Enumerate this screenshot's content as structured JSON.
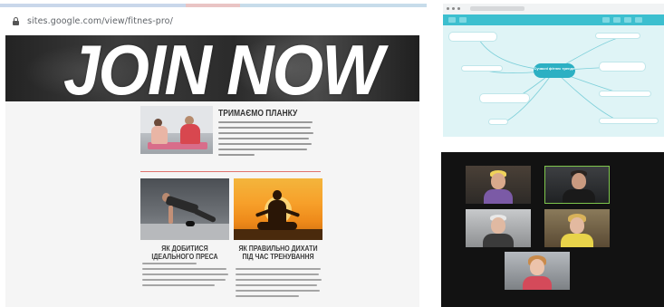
{
  "website": {
    "url": "sites.google.com/view/fitnes-pro/",
    "hero_title": "JOIN NOW",
    "article": {
      "title": "ТРИМАЄМО ПЛАНКУ"
    },
    "cards": [
      {
        "title": "ЯК ДОБИТИСЯ ІДЕАЛЬНОГО ПРЕСА"
      },
      {
        "title": "ЯК ПРАВИЛЬНО ДИХАТИ ПІД ЧАС ТРЕНУВАННЯ"
      }
    ]
  },
  "mindmap": {
    "center": "Сучасні фітнес тренди"
  },
  "colors": {
    "accent_divider": "#e0736f",
    "mindmap_bg": "#dff4f6",
    "mindmap_center": "#2cb0c3",
    "call_active_border": "#7ec64c"
  }
}
